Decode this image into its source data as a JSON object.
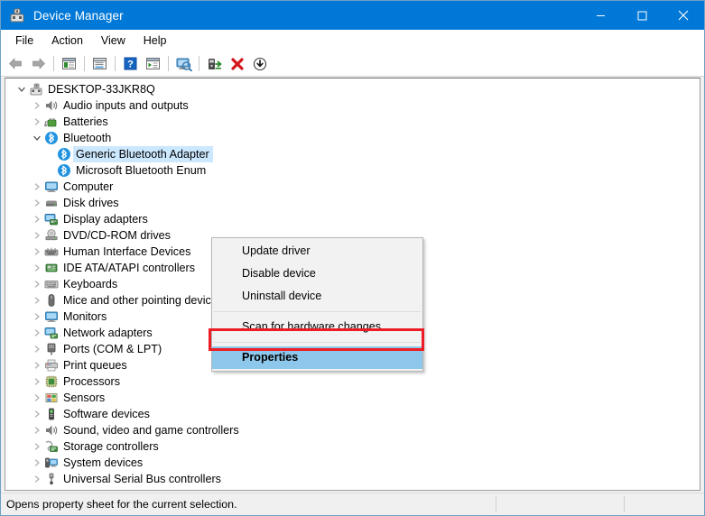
{
  "window": {
    "title": "Device Manager",
    "icon": "device-manager-icon",
    "controls": {
      "minimize": "–",
      "maximize": "❐",
      "close": "×"
    }
  },
  "menubar": {
    "items": [
      {
        "label": "File"
      },
      {
        "label": "Action"
      },
      {
        "label": "View"
      },
      {
        "label": "Help"
      }
    ]
  },
  "toolbar": {
    "buttons": [
      {
        "name": "back-arrow-icon",
        "tooltip": "Back"
      },
      {
        "name": "forward-arrow-icon",
        "tooltip": "Forward"
      },
      {
        "name": "show-hide-console-tree-icon",
        "tooltip": "Show/hide console tree"
      },
      {
        "name": "properties-icon",
        "tooltip": "Properties"
      },
      {
        "name": "help-icon",
        "tooltip": "Help"
      },
      {
        "name": "show-hide-action-pane-icon",
        "tooltip": "Show/hide action pane"
      },
      {
        "name": "scan-for-hardware-changes-icon",
        "tooltip": "Scan for hardware changes"
      },
      {
        "name": "update-driver-icon",
        "tooltip": "Update driver"
      },
      {
        "name": "uninstall-device-icon",
        "tooltip": "Uninstall device"
      },
      {
        "name": "disable-device-icon",
        "tooltip": "Disable device"
      }
    ]
  },
  "tree": {
    "root": {
      "label": "DESKTOP-33JKR8Q",
      "icon": "computer-root-icon",
      "expanded": true
    },
    "nodes": [
      {
        "label": "Audio inputs and outputs",
        "icon": "speaker-icon",
        "depth": 1,
        "expanded": false
      },
      {
        "label": "Batteries",
        "icon": "battery-icon",
        "depth": 1,
        "expanded": false
      },
      {
        "label": "Bluetooth",
        "icon": "bluetooth-icon",
        "depth": 1,
        "expanded": true
      },
      {
        "label": "Generic Bluetooth Adapter",
        "icon": "bluetooth-icon",
        "depth": 2,
        "selected": true
      },
      {
        "label": "Microsoft Bluetooth Enum",
        "icon": "bluetooth-icon",
        "depth": 2,
        "selected": false
      },
      {
        "label": "Computer",
        "icon": "monitor-icon",
        "depth": 1,
        "expanded": false
      },
      {
        "label": "Disk drives",
        "icon": "disk-drive-icon",
        "depth": 1,
        "expanded": false
      },
      {
        "label": "Display adapters",
        "icon": "display-adapter-icon",
        "depth": 1,
        "expanded": false
      },
      {
        "label": "DVD/CD-ROM drives",
        "icon": "dvd-drive-icon",
        "depth": 1,
        "expanded": false
      },
      {
        "label": "Human Interface Devices",
        "icon": "hid-icon",
        "depth": 1,
        "expanded": false
      },
      {
        "label": "IDE ATA/ATAPI controllers",
        "icon": "ide-controller-icon",
        "depth": 1,
        "expanded": false
      },
      {
        "label": "Keyboards",
        "icon": "keyboard-icon",
        "depth": 1,
        "expanded": false
      },
      {
        "label": "Mice and other pointing devices",
        "icon": "mouse-icon",
        "depth": 1,
        "expanded": false
      },
      {
        "label": "Monitors",
        "icon": "monitor-icon",
        "depth": 1,
        "expanded": false
      },
      {
        "label": "Network adapters",
        "icon": "network-adapter-icon",
        "depth": 1,
        "expanded": false
      },
      {
        "label": "Ports (COM & LPT)",
        "icon": "port-icon",
        "depth": 1,
        "expanded": false
      },
      {
        "label": "Print queues",
        "icon": "printer-icon",
        "depth": 1,
        "expanded": false
      },
      {
        "label": "Processors",
        "icon": "processor-icon",
        "depth": 1,
        "expanded": false
      },
      {
        "label": "Sensors",
        "icon": "sensor-icon",
        "depth": 1,
        "expanded": false
      },
      {
        "label": "Software devices",
        "icon": "software-device-icon",
        "depth": 1,
        "expanded": false
      },
      {
        "label": "Sound, video and game controllers",
        "icon": "speaker-icon",
        "depth": 1,
        "expanded": false
      },
      {
        "label": "Storage controllers",
        "icon": "storage-controller-icon",
        "depth": 1,
        "expanded": false
      },
      {
        "label": "System devices",
        "icon": "system-device-icon",
        "depth": 1,
        "expanded": false
      },
      {
        "label": "Universal Serial Bus controllers",
        "icon": "usb-icon",
        "depth": 1,
        "expanded": false
      }
    ]
  },
  "context_menu": {
    "items": [
      {
        "label": "Update driver",
        "highlighted": false
      },
      {
        "label": "Disable device",
        "highlighted": false
      },
      {
        "label": "Uninstall device",
        "highlighted": false
      },
      {
        "separator": true
      },
      {
        "label": "Scan for hardware changes",
        "highlighted": false
      },
      {
        "separator": true
      },
      {
        "label": "Properties",
        "highlighted": true
      }
    ]
  },
  "statusbar": {
    "text": "Opens property sheet for the current selection."
  },
  "colors": {
    "titlebar": "#0078d7",
    "selection": "#cce8ff",
    "menu_highlight": "#8ec7ec",
    "annotation": "#ee1c25",
    "bluetooth": "#1e90e0"
  }
}
